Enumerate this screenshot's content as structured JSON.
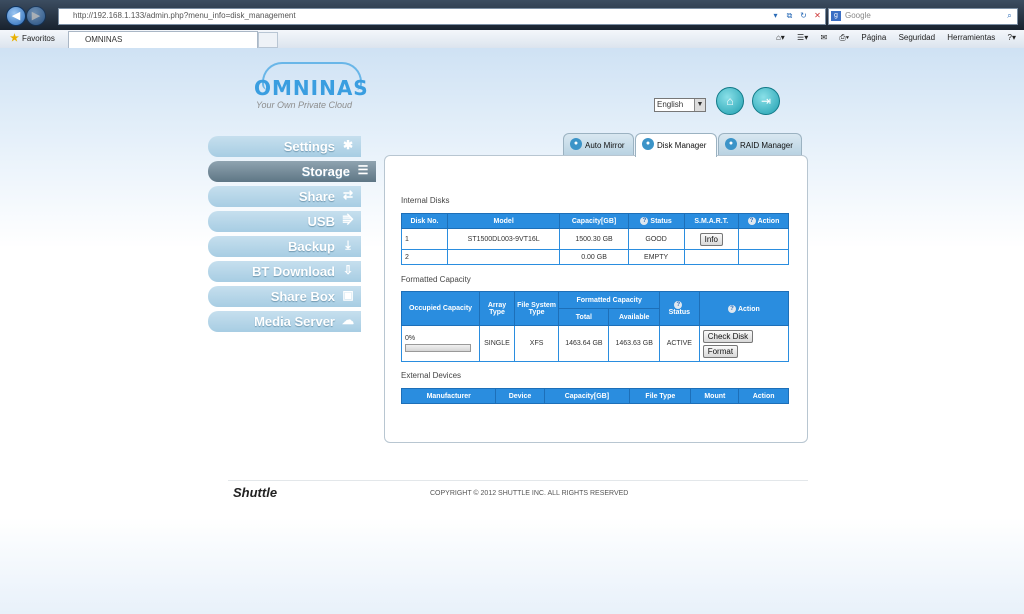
{
  "browser": {
    "url": "http://192.168.1.133/admin.php?menu_info=disk_management",
    "search_placeholder": "Google",
    "favorites_label": "Favoritos",
    "tab_title": "OMNINAS",
    "tools": [
      "Página",
      "Seguridad",
      "Herramientas"
    ]
  },
  "brand": {
    "name": "OMNINAS",
    "tagline": "Your Own Private Cloud"
  },
  "language": {
    "selected": "English"
  },
  "sidebar": {
    "items": [
      {
        "label": "Settings",
        "icon": "settings-icon"
      },
      {
        "label": "Storage",
        "icon": "storage-icon",
        "active": true
      },
      {
        "label": "Share",
        "icon": "share-icon"
      },
      {
        "label": "USB",
        "icon": "usb-icon"
      },
      {
        "label": "Backup",
        "icon": "backup-icon"
      },
      {
        "label": "BT Download",
        "icon": "bt-download-icon"
      },
      {
        "label": "Share Box",
        "icon": "share-box-icon"
      },
      {
        "label": "Media Server",
        "icon": "media-server-icon"
      }
    ]
  },
  "tabs": [
    {
      "label": "Auto Mirror"
    },
    {
      "label": "Disk Manager",
      "active": true
    },
    {
      "label": "RAID Manager"
    }
  ],
  "internal_disks": {
    "title": "Internal Disks",
    "headers": [
      "Disk No.",
      "Model",
      "Capacity[GB]",
      "Status",
      "S.M.A.R.T.",
      "Action"
    ],
    "rows": [
      {
        "no": "1",
        "model": "ST1500DL003-9VT16L",
        "capacity": "1500.30 GB",
        "status": "GOOD",
        "smart": "Info",
        "action": ""
      },
      {
        "no": "2",
        "model": "",
        "capacity": "0.00 GB",
        "status": "EMPTY",
        "smart": "",
        "action": ""
      }
    ]
  },
  "formatted": {
    "title": "Formatted Capacity",
    "headers": {
      "occupied": "Occupied Capacity",
      "array_type": "Array Type",
      "fs_type": "File System Type",
      "formatted": "Formatted Capacity",
      "total": "Total",
      "available": "Available",
      "status": "Status",
      "action": "Action"
    },
    "row": {
      "occupied_pct_label": "0%",
      "occupied_fraction": 0,
      "array_type": "SINGLE",
      "fs_type": "XFS",
      "total": "1463.64 GB",
      "available": "1463.63 GB",
      "status": "ACTIVE",
      "check_label": "Check Disk",
      "format_label": "Format"
    }
  },
  "external": {
    "title": "External Devices",
    "headers": [
      "Manufacturer",
      "Device",
      "Capacity[GB]",
      "File Type",
      "Mount",
      "Action"
    ]
  },
  "footer": {
    "logo": "Shuttle",
    "copyright": "COPYRIGHT © 2012 SHUTTLE INC. ALL RIGHTS RESERVED"
  }
}
